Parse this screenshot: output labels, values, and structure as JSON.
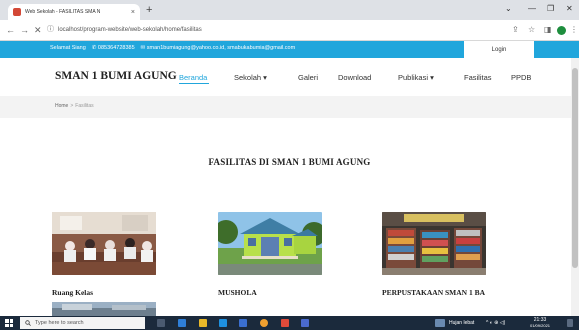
{
  "browser": {
    "tab_title": "Web Sekolah - FASILITAS SMA N",
    "tab_close": "×",
    "new_tab": "+",
    "url": "localhost/program-website/web-sekolah/home/fasilitas",
    "url_info": "ⓘ",
    "nav_back": "←",
    "nav_forward": "→",
    "nav_reload": "✕",
    "win_chevron": "⌄",
    "win_minimize": "—",
    "win_restore": "❐",
    "win_close": "✕",
    "share": "⇪",
    "star": "☆",
    "sidepanel": "◨",
    "menu": "⋮"
  },
  "topbar": {
    "greeting": "Selamat Siang",
    "phone": "✆ 085364728385",
    "email": "✉ sman1bumiagung@yahoo.co.id, smabukabumia@gmail.com",
    "login_label": "Login"
  },
  "header": {
    "brand": "SMAN 1 BUMI AGUNG",
    "nav": [
      {
        "label": "Beranda",
        "active": true
      },
      {
        "label": "Sekolah ▾",
        "active": false
      },
      {
        "label": "Galeri",
        "active": false
      },
      {
        "label": "Download",
        "active": false
      },
      {
        "label": "Publikasi ▾",
        "active": false
      },
      {
        "label": "Fasilitas",
        "active": false
      },
      {
        "label": "PPDB",
        "active": false
      }
    ]
  },
  "breadcrumb": {
    "home": "Home",
    "sep": ">",
    "current": "Fasilitas"
  },
  "main": {
    "title": "FASILITAS DI SMAN 1 BUMI AGUNG",
    "cards": [
      {
        "title": "Ruang Kelas",
        "image": "classroom-photo"
      },
      {
        "title": "MUSHOLA",
        "image": "mosque-building-photo"
      },
      {
        "title": "PERPUSTAKAAN SMAN 1 BA",
        "image": "library-photo"
      }
    ]
  },
  "taskbar": {
    "search_placeholder": "Type here to search",
    "weather": "Hujan lebat",
    "tray_icons": "^ ◐ ⊕ ◁)",
    "time": "21:33",
    "date": "01/09/2021"
  },
  "colors": {
    "accent": "#21a6dc",
    "taskbar": "#1b2a3c"
  }
}
